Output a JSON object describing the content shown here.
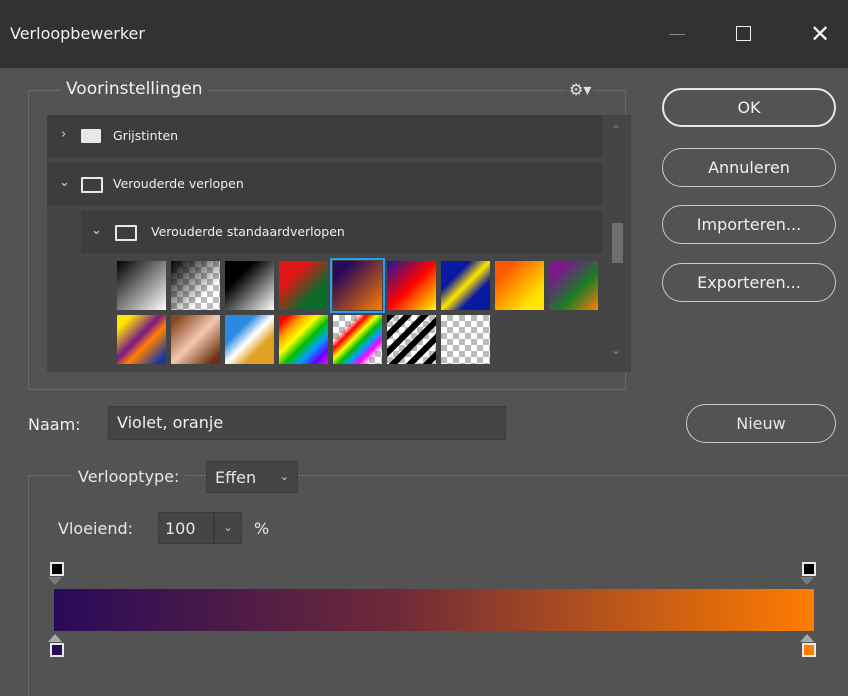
{
  "window": {
    "title": "Verloopbewerker",
    "controls": {
      "minimize": "—",
      "maximize": "☐",
      "close": "✕"
    }
  },
  "presets": {
    "legend": "Voorinstellingen",
    "settings_icon": "gear-icon",
    "folders": [
      {
        "label": "Grijstinten",
        "expanded": false
      },
      {
        "label": "Verouderde verlopen",
        "expanded": true
      },
      {
        "label": "Verouderde standaardverlopen",
        "expanded": true
      }
    ]
  },
  "buttons": {
    "ok": "OK",
    "cancel": "Annuleren",
    "import": "Importeren...",
    "export": "Exporteren...",
    "new": "Nieuw"
  },
  "name_field": {
    "label": "Naam:",
    "value": "Violet, oranje"
  },
  "gradient_type": {
    "label": "Verlooptype:",
    "value": "Effen"
  },
  "smoothness": {
    "label": "Vloeiend:",
    "value": "100",
    "unit": "%"
  },
  "gradient": {
    "colors": {
      "start": "#290a59",
      "end": "#ff7c00"
    },
    "selected_preset_index": 4
  },
  "swatch_colors": {
    "accent_selection": "#2d9bf0",
    "background": "#535353",
    "titlebar": "#323232"
  }
}
